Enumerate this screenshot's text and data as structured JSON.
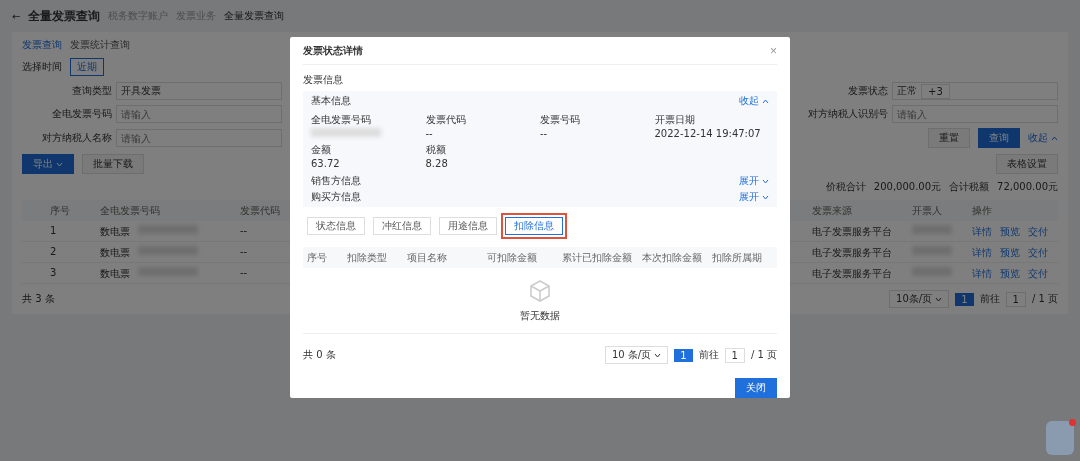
{
  "header": {
    "back": "←",
    "title": "全量发票查询",
    "breadcrumbs": [
      "税务数字账户",
      "发票业务",
      "全量发票查询"
    ]
  },
  "page_tabs": [
    {
      "label": "发票查询",
      "selected": true
    },
    {
      "label": "发票统计查询",
      "selected": false
    }
  ],
  "time_filter": {
    "label": "选择时间",
    "option": "近期"
  },
  "filters": [
    {
      "label": "查询类型",
      "kind": "select",
      "value": "开具发票"
    },
    {
      "label": "发票状态",
      "kind": "select",
      "value": "正常",
      "extra": "+3"
    },
    {
      "label": "全电发票号码",
      "kind": "input",
      "placeholder": "请输入"
    },
    {
      "label": "对方纳税人识别号",
      "kind": "input",
      "placeholder": "请输入"
    },
    {
      "label": "对方纳税人名称",
      "kind": "input",
      "placeholder": "请输入"
    }
  ],
  "filter_actions": {
    "reset": "重置",
    "search": "查询",
    "collapse": "收起"
  },
  "toolbar": {
    "export": "导出",
    "batch": "批量下载",
    "settings": "表格设置"
  },
  "summary": [
    {
      "label": "价税合计",
      "value": "200,000.00元"
    },
    {
      "label": "合计税额",
      "value": "72,000.00元"
    }
  ],
  "table": {
    "columns": [
      "序号",
      "全电发票号码",
      "发票代码",
      "发票来源",
      "开票人",
      "操作"
    ],
    "rows": [
      {
        "index": "1",
        "number": "数电票",
        "code": "--",
        "source": "电子发票服务平台",
        "actions": [
          "详情",
          "预览",
          "交付"
        ]
      },
      {
        "index": "2",
        "number": "数电票",
        "code": "--",
        "source": "电子发票服务平台",
        "actions": [
          "详情",
          "预览",
          "交付"
        ]
      },
      {
        "index": "3",
        "number": "数电票",
        "code": "--",
        "source": "电子发票服务平台",
        "actions": [
          "详情",
          "预览",
          "交付"
        ]
      }
    ],
    "total": "共 3 条",
    "page_size": "10条/页",
    "pages": [
      {
        "label": "1",
        "selected": true
      }
    ],
    "goto": "前往",
    "goto_value": "1",
    "page_count": "/ 1 页"
  },
  "modal": {
    "title": "发票状态详情",
    "close": "×",
    "section": "发票信息",
    "basic": {
      "title": "基本信息",
      "toggle": "收起",
      "expanded": true,
      "fields": [
        {
          "label": "全电发票号码",
          "redacted": true
        },
        {
          "label": "发票代码",
          "value": "--"
        },
        {
          "label": "发票号码",
          "value": "--"
        },
        {
          "label": "开票日期",
          "value": "2022-12-14 19:47:07"
        },
        {
          "label": "金额",
          "value": "63.72"
        },
        {
          "label": "税额",
          "value": "8.28"
        }
      ]
    },
    "collapsed": [
      {
        "title": "销售方信息",
        "toggle": "展开",
        "expanded": false
      },
      {
        "title": "购买方信息",
        "toggle": "展开",
        "expanded": false
      }
    ],
    "tabs": [
      {
        "label": "状态信息",
        "selected": false,
        "highlighted": false
      },
      {
        "label": "冲红信息",
        "selected": false,
        "highlighted": false
      },
      {
        "label": "用途信息",
        "selected": false,
        "highlighted": false
      },
      {
        "label": "扣除信息",
        "selected": true,
        "highlighted": true
      }
    ],
    "columns": [
      "序号",
      "扣除类型",
      "项目名称",
      "可扣除金额",
      "累计已扣除金额",
      "本次扣除金额",
      "扣除所属期"
    ],
    "empty": "暂无数据",
    "total": "共 0 条",
    "page_size": "10 条/页",
    "pages": [
      {
        "label": "1",
        "selected": true
      }
    ],
    "goto": "前往",
    "goto_value": "1",
    "page_count": "/ 1 页",
    "close_button": "关闭"
  },
  "assistant": {
    "notification": true
  }
}
